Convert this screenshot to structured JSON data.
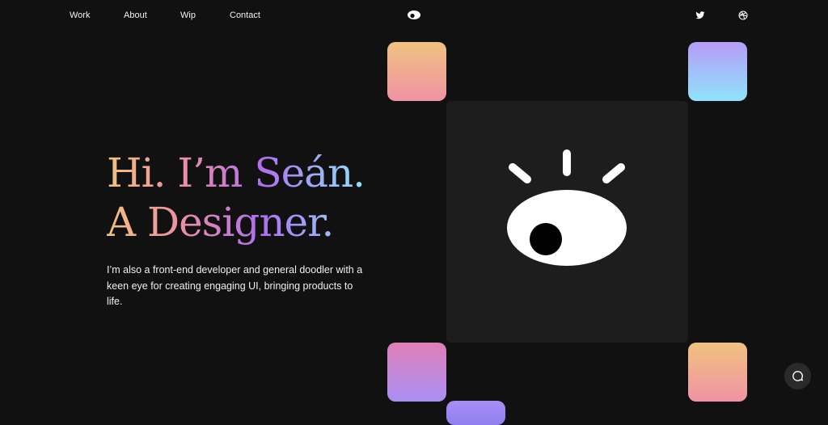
{
  "nav": {
    "work": "Work",
    "about": "About",
    "wip": "Wip",
    "contact": "Contact"
  },
  "hero": {
    "line1": "Hi. I’m Seán.",
    "line2": "A Designer.",
    "description": "I’m also a front-end developer and general doodler with a keen eye for creating engaging UI, bringing products to life."
  },
  "icons": {
    "logo": "eye-icon",
    "twitter": "twitter-icon",
    "dribbble": "dribbble-icon",
    "illustration": "eye-icon",
    "chat": "chat-icon"
  },
  "colors": {
    "background": "#111111",
    "panel": "#1d1d1d",
    "gradient_start": "#f0c27f",
    "gradient_pink": "#ee8fa3",
    "gradient_purple": "#b06ef0",
    "gradient_end": "#8fe3fb"
  }
}
